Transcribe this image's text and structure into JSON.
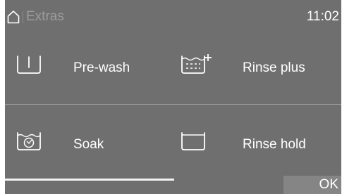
{
  "header": {
    "home_icon": "house-icon",
    "title": "Extras",
    "time": "11:02"
  },
  "extras": [
    {
      "label": "Pre-wash",
      "icon": "pre-wash-tub-icon"
    },
    {
      "label": "Rinse plus",
      "icon": "rinse-plus-icon"
    },
    {
      "label": "Soak",
      "icon": "soak-icon"
    },
    {
      "label": "Rinse hold",
      "icon": "rinse-hold-tub-icon"
    }
  ],
  "footer": {
    "ok_label": "OK"
  },
  "colors": {
    "background": "#6f6f6f",
    "text": "#ffffff",
    "title_dim": "#9c9c9c",
    "ok_button": "#858585"
  }
}
